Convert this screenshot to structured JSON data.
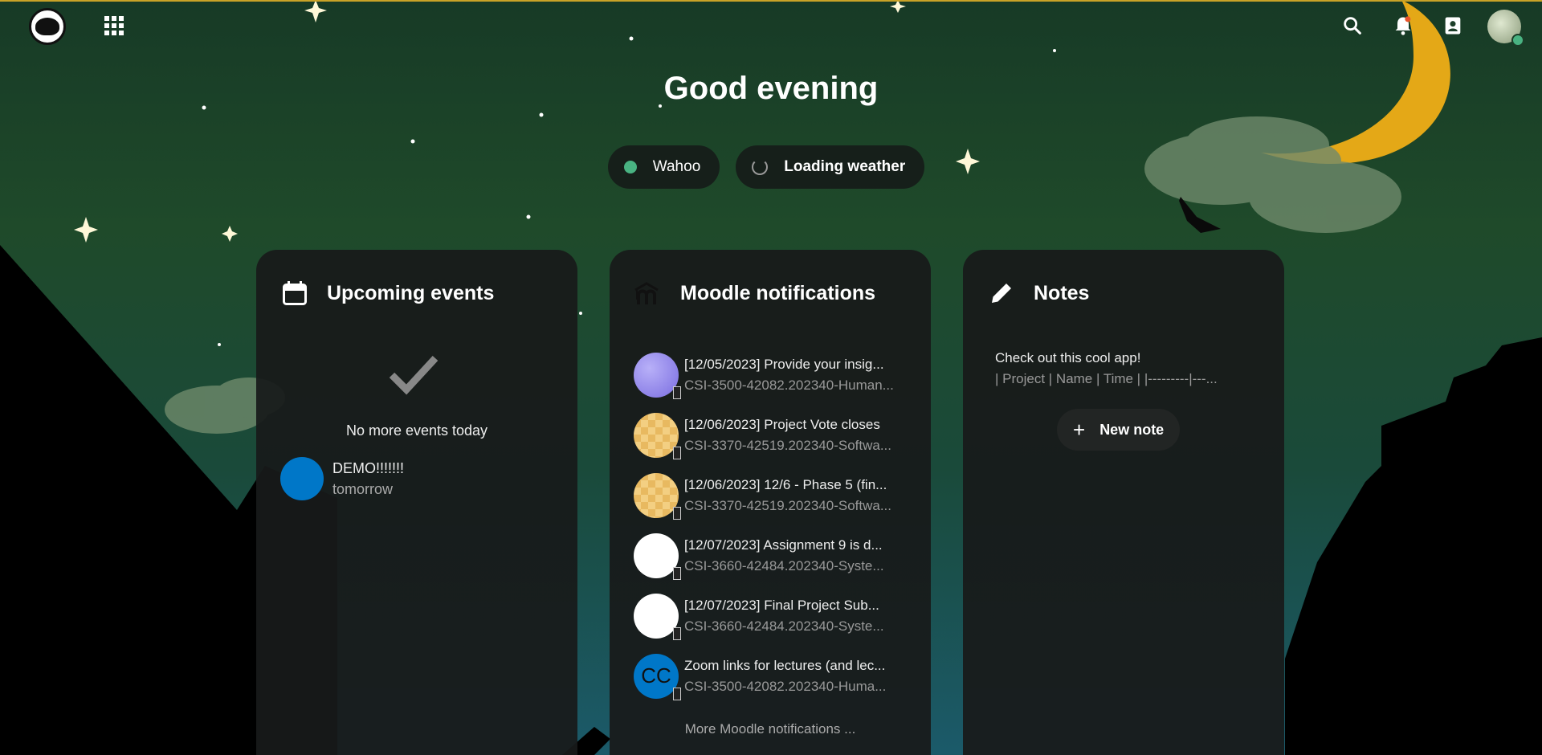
{
  "header": {
    "logo_alt": "logo",
    "greeting": "Good evening"
  },
  "status": {
    "user_status": "Wahoo",
    "user_status_color": "#49b382",
    "weather": "Loading weather"
  },
  "events_card": {
    "title": "Upcoming events",
    "empty_message": "No more events today",
    "events": [
      {
        "title": "DEMO!!!!!!!",
        "when": "tomorrow",
        "color": "#0077c8"
      }
    ]
  },
  "moodle_card": {
    "title": "Moodle notifications",
    "items": [
      {
        "title": "[12/05/2023] Provide your insig...",
        "course": "CSI-3500-42082.202340-Human...",
        "avatar": "purple",
        "initials": ""
      },
      {
        "title": "[12/06/2023] Project Vote closes",
        "course": "CSI-3370-42519.202340-Softwa...",
        "avatar": "gold",
        "initials": ""
      },
      {
        "title": "[12/06/2023] 12/6 - Phase 5 (fin...",
        "course": "CSI-3370-42519.202340-Softwa...",
        "avatar": "gold",
        "initials": ""
      },
      {
        "title": "[12/07/2023] Assignment 9 is d...",
        "course": "CSI-3660-42484.202340-Syste...",
        "avatar": "white",
        "initials": ""
      },
      {
        "title": "[12/07/2023] Final Project Sub...",
        "course": "CSI-3660-42484.202340-Syste...",
        "avatar": "white",
        "initials": ""
      },
      {
        "title": "Zoom links for lectures (and lec...",
        "course": "CSI-3500-42082.202340-Huma...",
        "avatar": "blue",
        "initials": "CC"
      }
    ],
    "more_link": "More Moodle notifications ..."
  },
  "notes_card": {
    "title": "Notes",
    "note_line1": "Check out this cool app!",
    "note_line2": "| Project | Name | Time |    |---------|---...",
    "new_note_label": "New note"
  },
  "colors": {
    "accent_gold": "#c9a227",
    "card_bg": "#181a1a",
    "event_blue": "#0077c8"
  },
  "icons": [
    "apps-icon",
    "search-icon",
    "bell-icon",
    "contacts-icon",
    "calendar-icon",
    "moodle-icon",
    "pencil-icon",
    "check-icon",
    "plus-icon"
  ]
}
